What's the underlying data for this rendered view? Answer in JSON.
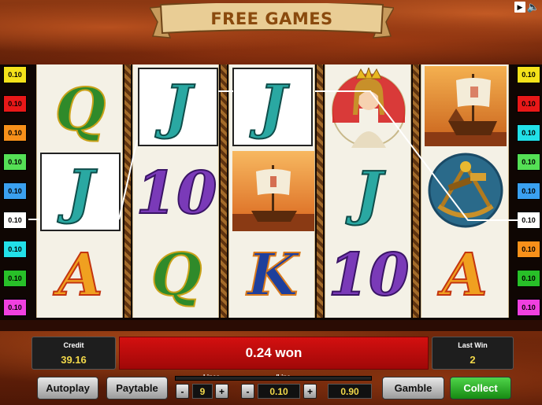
{
  "banner": {
    "title": "FREE GAMES"
  },
  "top_controls": {
    "play_icon": "play-icon",
    "sound_icon": "speaker-icon"
  },
  "lines": {
    "bet_label": "0.10",
    "left": [
      {
        "label": "0.10",
        "color": "#f4e21a"
      },
      {
        "label": "0.10",
        "color": "#e81818"
      },
      {
        "label": "0.10",
        "color": "#f7901a"
      },
      {
        "label": "0.10",
        "color": "#55e055"
      },
      {
        "label": "0.10",
        "color": "#3aa0f0"
      },
      {
        "label": "0.10",
        "color": "#ffffff"
      },
      {
        "label": "0.10",
        "color": "#22e0e8"
      },
      {
        "label": "0.10",
        "color": "#28c028"
      },
      {
        "label": "0.10",
        "color": "#f040e0"
      }
    ],
    "right": [
      {
        "label": "0.10",
        "color": "#f4e21a"
      },
      {
        "label": "0.10",
        "color": "#e81818"
      },
      {
        "label": "0.10",
        "color": "#22e0e8"
      },
      {
        "label": "0.10",
        "color": "#55e055"
      },
      {
        "label": "0.10",
        "color": "#3aa0f0"
      },
      {
        "label": "0.10",
        "color": "#ffffff"
      },
      {
        "label": "0.10",
        "color": "#f7901a"
      },
      {
        "label": "0.10",
        "color": "#28c028"
      },
      {
        "label": "0.10",
        "color": "#f040e0"
      }
    ]
  },
  "reels": [
    [
      "Q",
      "J",
      "A"
    ],
    [
      "J",
      "10",
      "Q"
    ],
    [
      "J",
      "ship",
      "K"
    ],
    [
      "queen",
      "J",
      "10"
    ],
    [
      "ship",
      "sextant",
      "A"
    ]
  ],
  "panel": {
    "credit_label": "Credit",
    "credit_value": "39.16",
    "won_text": "0.24 won",
    "last_win_label": "Last Win",
    "last_win_value": "2",
    "autoplay": "Autoplay",
    "paytable": "Paytable",
    "lines_label": "Lines",
    "lines_value": "9",
    "per_line_label": "/Line",
    "per_line_value": "0.10",
    "total_bet": "0.90",
    "gamble": "Gamble",
    "collect": "Collect",
    "minus": "-",
    "plus": "+"
  }
}
